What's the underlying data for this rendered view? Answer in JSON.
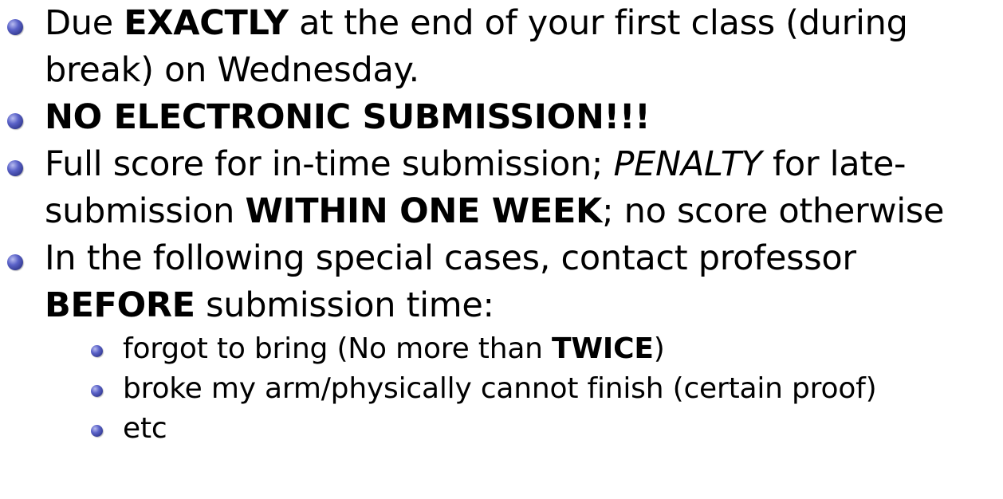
{
  "bullets": [
    {
      "pre": "Due ",
      "bold": "EXACTLY",
      "post": " at the end of your first class (during break) on Wednesday."
    },
    {
      "bold": "NO ELECTRONIC SUBMISSION!!!"
    },
    {
      "pre": "Full score for in-time submission; ",
      "italic": "PENALTY",
      "mid": " for late-submission ",
      "bold": "WITHIN ONE WEEK",
      "post": "; no score otherwise"
    },
    {
      "pre": "In the following special cases, contact professor ",
      "bold": "BEFORE",
      "post": " submission time:",
      "subitems": [
        {
          "pre": "forgot to bring (No more than ",
          "bold": "TWICE",
          "post": ")"
        },
        {
          "text": "broke my arm/physically cannot finish (certain proof)"
        },
        {
          "text": "etc"
        }
      ]
    }
  ]
}
